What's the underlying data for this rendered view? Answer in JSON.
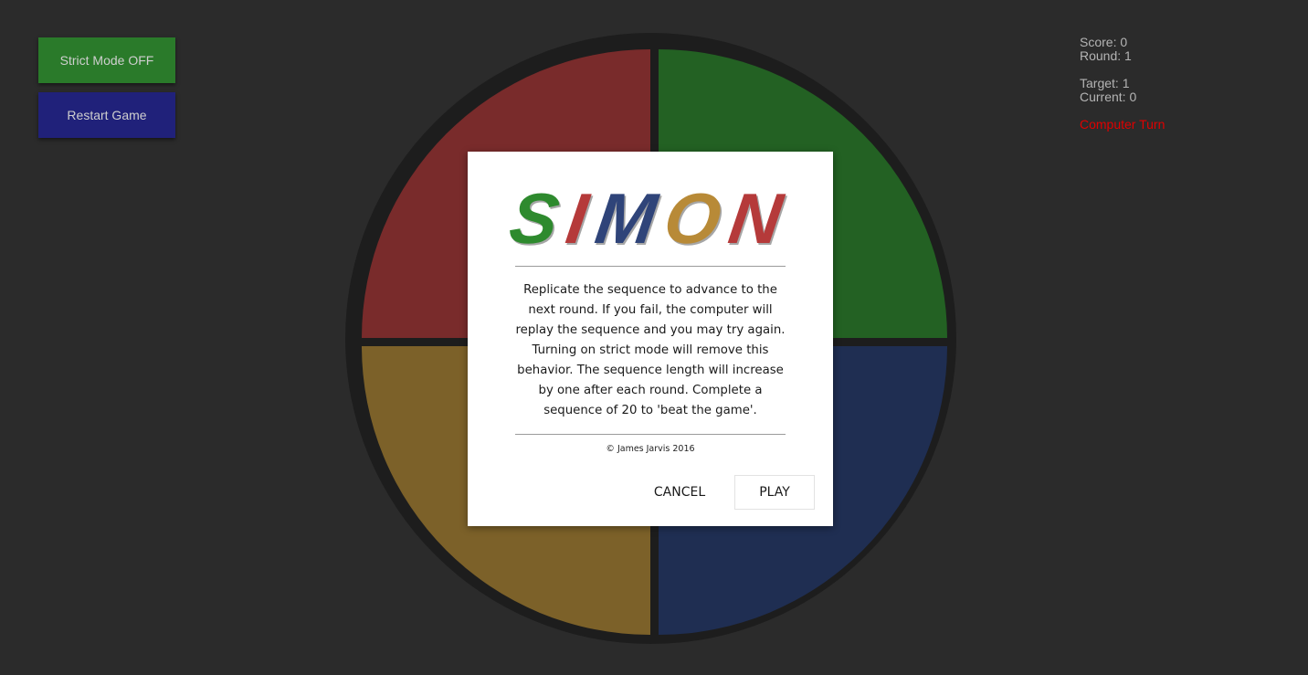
{
  "controls": {
    "strict_label": "Strict Mode OFF",
    "restart_label": "Restart Game"
  },
  "status": {
    "score": "Score: 0",
    "round": "Round: 1",
    "target": "Target: 1",
    "current": "Current: 0",
    "turn": "Computer Turn"
  },
  "board": {
    "pads": [
      {
        "name": "red",
        "color": "#792b2b"
      },
      {
        "name": "green",
        "color": "#236123"
      },
      {
        "name": "yellow",
        "color": "#7c6129"
      },
      {
        "name": "blue",
        "color": "#1f2e52"
      }
    ]
  },
  "modal": {
    "logo_letters": [
      {
        "char": "S",
        "color": "#2e8a2e"
      },
      {
        "char": "I",
        "color": "#b53a3a"
      },
      {
        "char": "M",
        "color": "#2f4479"
      },
      {
        "char": "O",
        "color": "#b88a37"
      },
      {
        "char": "N",
        "color": "#b53a3a"
      }
    ],
    "description": "Replicate the sequence to advance to the next round. If you fail, the computer will replay the sequence and you may try again. Turning on strict mode will remove this behavior. The sequence length will increase by one after each round. Complete a sequence of 20 to 'beat the game'.",
    "copyright": "© James Jarvis 2016",
    "cancel_label": "CANCEL",
    "play_label": "PLAY"
  }
}
